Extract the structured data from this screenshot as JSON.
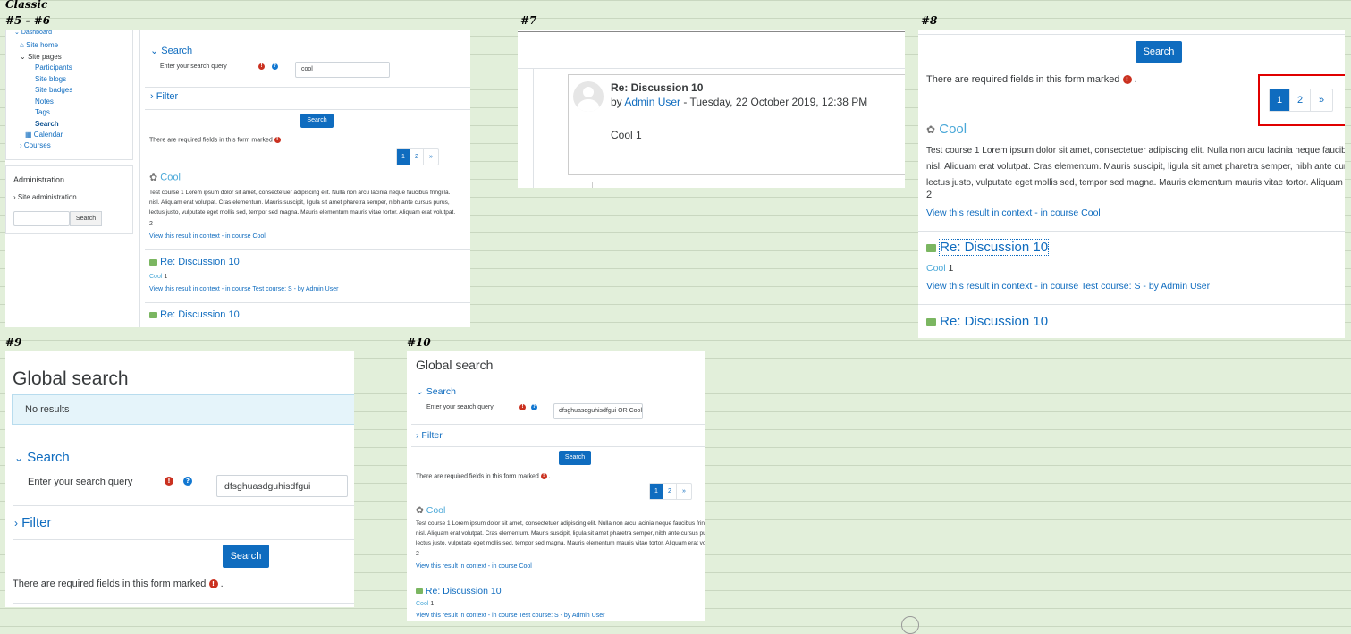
{
  "labels": {
    "classic": "Classic",
    "s56": "#5 - #6",
    "s7": "#7",
    "s8": "#8",
    "s9": "#9",
    "s10": "#10"
  },
  "nav": {
    "dashboard": "Dashboard",
    "site_home": "Site home",
    "site_pages": "Site pages",
    "participants": "Participants",
    "site_blogs": "Site blogs",
    "site_badges": "Site badges",
    "notes": "Notes",
    "tags": "Tags",
    "search": "Search",
    "calendar": "Calendar",
    "courses": "Courses"
  },
  "admin": {
    "title": "Administration",
    "site_admin": "Site administration",
    "search_btn": "Search"
  },
  "form": {
    "search_heading": "Search",
    "query_label": "Enter your search query",
    "filter_heading": "Filter",
    "search_btn": "Search",
    "required_note": "There are required fields in this form marked",
    "period": "."
  },
  "pagination": {
    "p1": "1",
    "p2": "2",
    "next": "»"
  },
  "results": {
    "r1_title": "Cool",
    "r1_line1": "Test course 1 Lorem ipsum dolor sit amet, consectetuer adipiscing elit. Nulla non arcu lacinia neque faucibus fringilla.",
    "r1_line2": "nisl. Aliquam erat volutpat. Cras elementum. Mauris suscipit, ligula sit amet pharetra semper, nibh ante cursus purus,",
    "r1_line3": "lectus justo, vulputate eget mollis sed, tempor sed magna. Mauris elementum mauris vitae tortor. Aliquam erat volutpat.",
    "r1_num": "2",
    "r1_link": "View this result in context",
    "r1_sep": " - ",
    "r1_course": "in course Cool",
    "r2_title": "Re: Discussion 10",
    "r2_course_link": "Cool",
    "r2_num": " 1",
    "r2_link": "View this result in context",
    "r2_sep1": " - ",
    "r2_course": "in course Test course: S",
    "r2_sep2": " - ",
    "r2_by": "by Admin User",
    "r3_title": "Re: Discussion 10"
  },
  "s56": {
    "query_value": "cool"
  },
  "s7": {
    "post_title": "Re: Discussion 10",
    "by": "by",
    "author": "Admin User",
    "date": " - Tuesday, 22 October 2019, 12:38 PM",
    "body": "Cool 1"
  },
  "s9": {
    "page_title": "Global search",
    "no_results": "No results",
    "query_value": "dfsghuasdguhisdfgui"
  },
  "s10": {
    "page_title": "Global search",
    "query_value": "dfsghuasdguhisdfgui OR Cool"
  }
}
